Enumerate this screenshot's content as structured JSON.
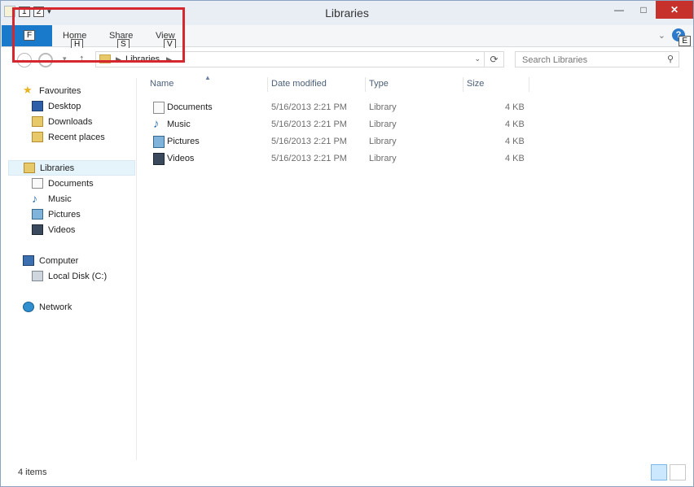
{
  "window": {
    "title": "Libraries",
    "qat_keytips": [
      "1",
      "2"
    ],
    "controls": {
      "minimize": "—",
      "maximize": "□",
      "close": "✕"
    }
  },
  "ribbon": {
    "file_keytip": "F",
    "tabs": [
      {
        "label": "Home",
        "keytip": "H"
      },
      {
        "label": "Share",
        "keytip": "S"
      },
      {
        "label": "View",
        "keytip": "V"
      }
    ],
    "help_keytip": "E",
    "help_icon": "?"
  },
  "address": {
    "crumb": "Libraries",
    "search_placeholder": "Search Libraries"
  },
  "nav": {
    "favourites": {
      "label": "Favourites",
      "items": [
        "Desktop",
        "Downloads",
        "Recent places"
      ]
    },
    "libraries": {
      "label": "Libraries",
      "items": [
        "Documents",
        "Music",
        "Pictures",
        "Videos"
      ]
    },
    "computer": {
      "label": "Computer",
      "items": [
        "Local Disk (C:)"
      ]
    },
    "network": {
      "label": "Network"
    }
  },
  "columns": [
    "Name",
    "Date modified",
    "Type",
    "Size"
  ],
  "files": [
    {
      "name": "Documents",
      "date": "5/16/2013 2:21 PM",
      "type": "Library",
      "size": "4 KB",
      "icon": "documents-library-icon"
    },
    {
      "name": "Music",
      "date": "5/16/2013 2:21 PM",
      "type": "Library",
      "size": "4 KB",
      "icon": "music-library-icon"
    },
    {
      "name": "Pictures",
      "date": "5/16/2013 2:21 PM",
      "type": "Library",
      "size": "4 KB",
      "icon": "pictures-library-icon"
    },
    {
      "name": "Videos",
      "date": "5/16/2013 2:21 PM",
      "type": "Library",
      "size": "4 KB",
      "icon": "videos-library-icon"
    }
  ],
  "status": {
    "text": "4 items"
  },
  "colors": {
    "file_tab": "#1979ca",
    "close_button": "#c7312b",
    "highlight_box": "#d6262e",
    "selected_nav": "#e5f3fb"
  }
}
